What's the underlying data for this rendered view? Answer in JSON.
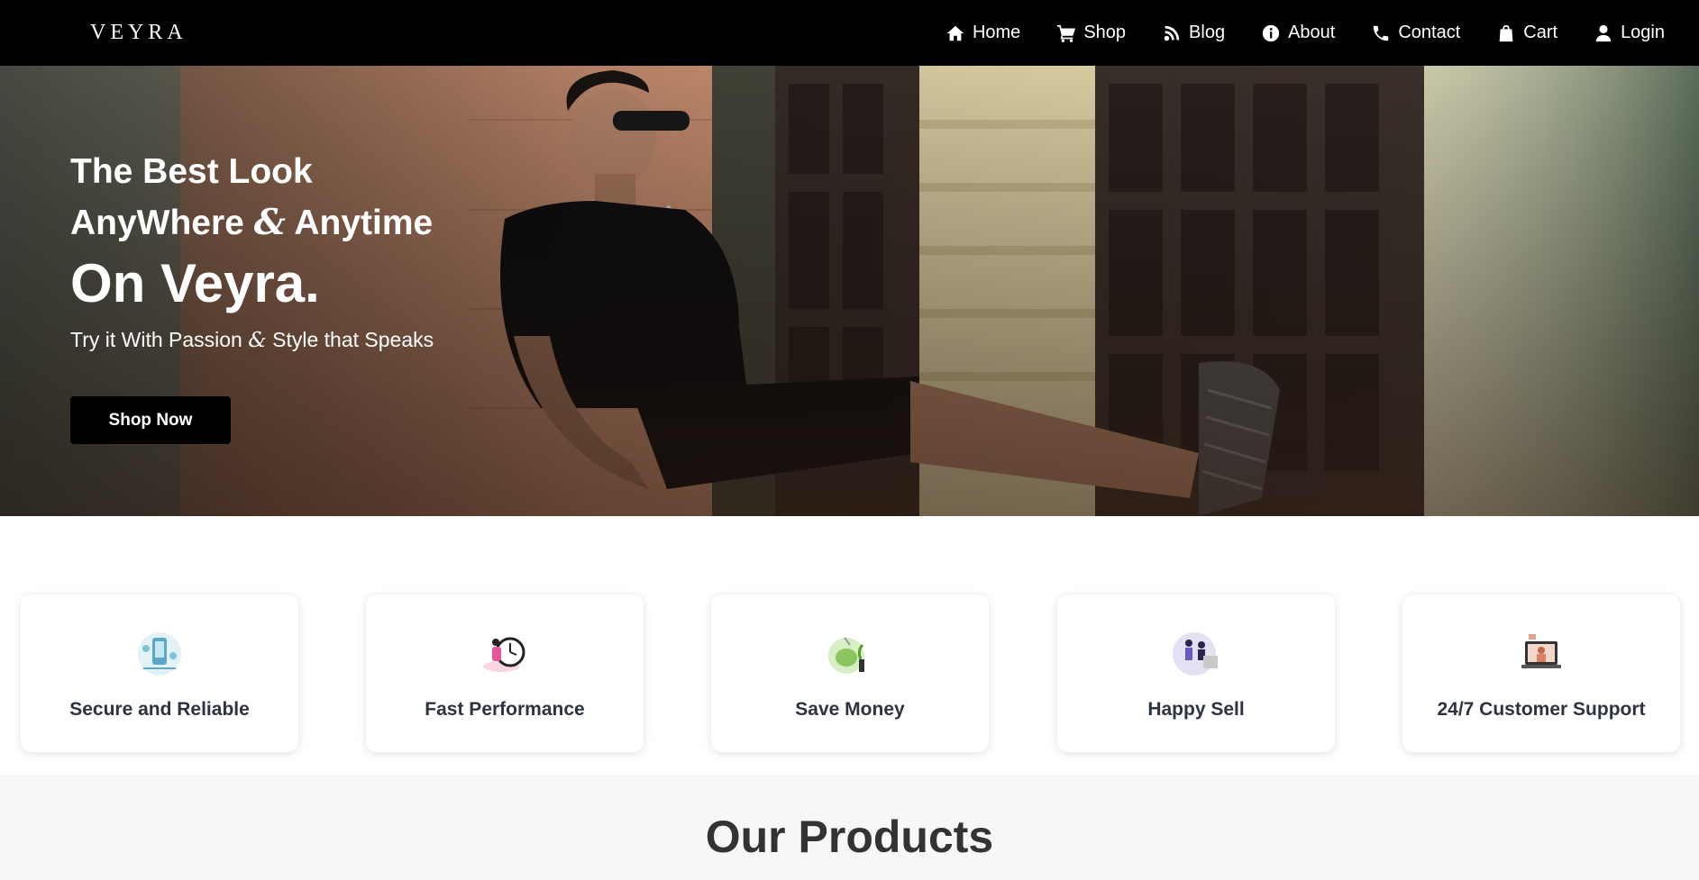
{
  "brand": {
    "logo": "VEYRA"
  },
  "nav": {
    "items": [
      {
        "label": "Home",
        "icon": "home-icon"
      },
      {
        "label": "Shop",
        "icon": "cart-icon"
      },
      {
        "label": "Blog",
        "icon": "blog-icon"
      },
      {
        "label": "About",
        "icon": "info-icon"
      },
      {
        "label": "Contact",
        "icon": "phone-icon"
      },
      {
        "label": "Cart",
        "icon": "bag-icon"
      },
      {
        "label": "Login",
        "icon": "user-icon"
      }
    ]
  },
  "hero": {
    "line1": "The Best Look",
    "line2a": "AnyWhere",
    "amp": "&",
    "line2b": "Anytime",
    "brand_line": "On Veyra.",
    "sub_a": "Try it With Passion",
    "sub_b": "Style that Speaks",
    "cta": "Shop Now"
  },
  "features": [
    {
      "label": "Secure and Reliable",
      "icon": "secure-illustration-icon"
    },
    {
      "label": "Fast Performance",
      "icon": "stopwatch-illustration-icon"
    },
    {
      "label": "Save Money",
      "icon": "piggy-bank-illustration-icon"
    },
    {
      "label": "Happy Sell",
      "icon": "team-illustration-icon"
    },
    {
      "label": "24/7 Customer Support",
      "icon": "support-illustration-icon"
    }
  ],
  "products": {
    "heading": "Our Products"
  },
  "colors": {
    "navbar": "#000000",
    "accent": "#000000",
    "card_text": "#2c3444",
    "section_bg": "#f7f7f7"
  }
}
